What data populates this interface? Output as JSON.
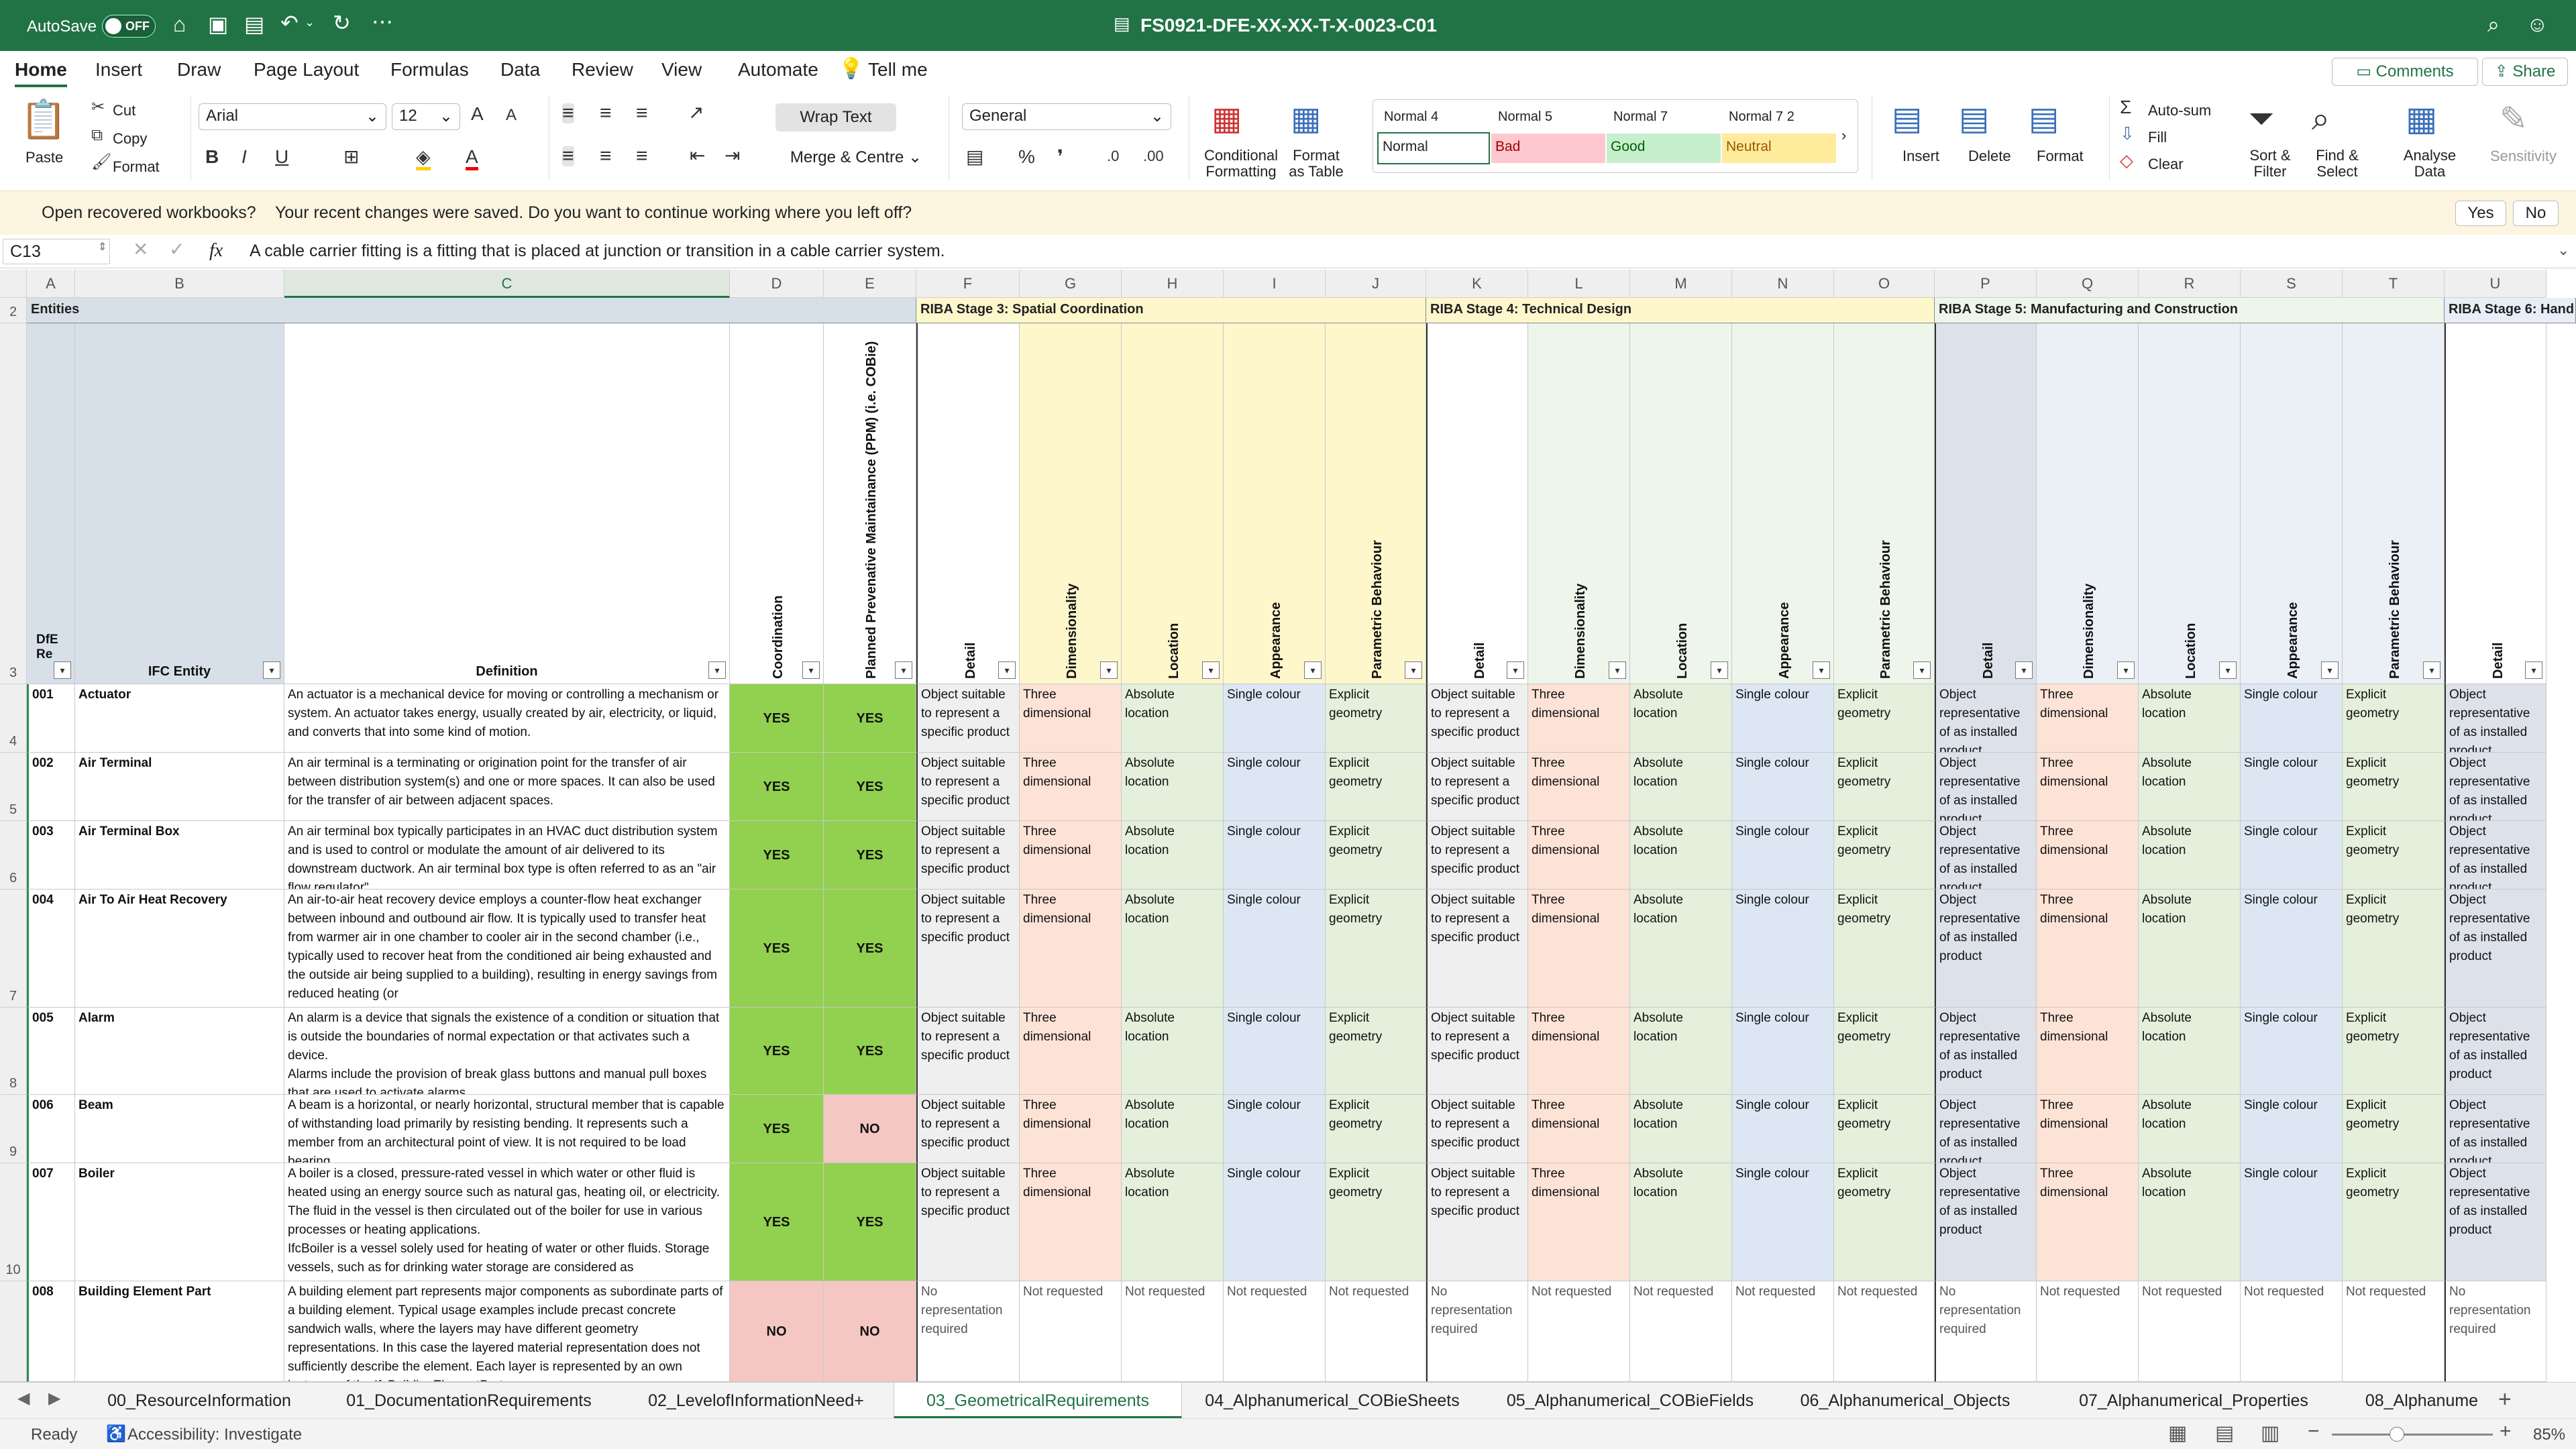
{
  "titlebar": {
    "autosave": "AutoSave",
    "toggle": "OFF",
    "filename": "FS0921-DFE-XX-XX-T-X-0023-C01"
  },
  "ribbon_tabs": [
    "Home",
    "Insert",
    "Draw",
    "Page Layout",
    "Formulas",
    "Data",
    "Review",
    "View",
    "Automate",
    "Tell me"
  ],
  "ribbon_right": {
    "comments": "Comments",
    "share": "Share"
  },
  "clipboard": {
    "paste": "Paste",
    "cut": "Cut",
    "copy": "Copy",
    "format": "Format"
  },
  "font": {
    "name": "Arial",
    "size": "12"
  },
  "alignment": {
    "wrap": "Wrap Text",
    "merge": "Merge & Centre"
  },
  "number": {
    "format": "General"
  },
  "styles": {
    "cond": "Conditional Formatting",
    "table": "Format as Table",
    "names": [
      "Normal 4",
      "Normal 5",
      "Normal 7",
      "Normal 7 2"
    ],
    "cells": [
      "Normal",
      "Bad",
      "Good",
      "Neutral"
    ]
  },
  "cells_grp": {
    "insert": "Insert",
    "delete": "Delete",
    "format": "Format"
  },
  "editing": {
    "autosum": "Auto-sum",
    "fill": "Fill",
    "clear": "Clear",
    "sort": "Sort & Filter",
    "find": "Find & Select",
    "analyse": "Analyse Data",
    "sensitivity": "Sensitivity"
  },
  "message": {
    "title": "Open recovered workbooks?",
    "text": "Your recent changes were saved. Do you want to continue working where you left off?",
    "yes": "Yes",
    "no": "No"
  },
  "formula": {
    "namebox": "C13",
    "fx": "fx",
    "content": "A cable carrier fitting is a fitting that is placed at junction or transition in a cable carrier system."
  },
  "columns": [
    "A",
    "B",
    "C",
    "D",
    "E",
    "F",
    "G",
    "H",
    "I",
    "J",
    "K",
    "L",
    "M",
    "N",
    "O",
    "P",
    "Q",
    "R",
    "S",
    "T",
    "U"
  ],
  "row_numbers": [
    "2",
    "3",
    "4",
    "5",
    "6",
    "7",
    "8",
    "9",
    "10"
  ],
  "header": {
    "entities": "Entities",
    "dfe_ref": "DfE Re",
    "ifc_entity": "IFC Entity",
    "definition": "Definition",
    "coordination": "Coordination",
    "ppm": "Planned Prevenative Maintainance (PPM) (i.e. COBie)",
    "stages": [
      "RIBA Stage 3: Spatial Coordination",
      "RIBA Stage 4: Technical Design",
      "RIBA Stage 5: Manufacturing and Construction",
      "RIBA Stage 6: Hand"
    ],
    "sub": [
      "Detail",
      "Dimensionality",
      "Location",
      "Appearance",
      "Parametric Behaviour"
    ]
  },
  "rows": [
    {
      "ref": "001",
      "entity": "Actuator",
      "def": "An actuator is a mechanical device for moving or controlling a mechanism or system. An actuator takes energy, usually created by air, electricity, or liquid, and converts that into some kind of motion.",
      "coord": "YES",
      "ppm": "YES"
    },
    {
      "ref": "002",
      "entity": "Air Terminal",
      "def": "An air terminal is a terminating or origination point for the transfer of air between distribution system(s) and one or more spaces. It can also be used for the transfer of air between adjacent spaces.",
      "coord": "YES",
      "ppm": "YES"
    },
    {
      "ref": "003",
      "entity": "Air Terminal Box",
      "def": "An air terminal box typically participates in an HVAC duct distribution system and is used to control or modulate the amount of air delivered to its downstream ductwork. An air terminal box type is often referred to as an \"air flow regulator\".",
      "coord": "YES",
      "ppm": "YES"
    },
    {
      "ref": "004",
      "entity": "Air To Air Heat Recovery",
      "def": "An air-to-air heat recovery device employs a counter-flow heat exchanger between inbound and outbound air flow. It is typically used to transfer heat from warmer air in one chamber to cooler air in the second chamber (i.e., typically used to recover heat from the conditioned air being exhausted and the outside air being supplied to a building), resulting in energy savings from reduced heating (or",
      "coord": "YES",
      "ppm": "YES"
    },
    {
      "ref": "005",
      "entity": "Alarm",
      "def": "An alarm is a device that signals the existence of a condition or situation that is outside the boundaries of normal expectation or that activates such a device.\nAlarms include the provision of break glass buttons and manual pull boxes that are used to activate alarms.",
      "coord": "YES",
      "ppm": "YES"
    },
    {
      "ref": "006",
      "entity": "Beam",
      "def": "A beam is a horizontal, or nearly horizontal, structural member that is capable of withstanding load primarily by resisting bending. It represents such a member from an architectural point of view. It is not required to be load bearing.",
      "coord": "YES",
      "ppm": "NO"
    },
    {
      "ref": "007",
      "entity": "Boiler",
      "def": "A boiler is a closed, pressure-rated vessel in which water or other fluid is heated using an energy source such as natural gas, heating oil, or electricity. The fluid in the vessel is then circulated out of the boiler for use in various processes or heating applications.\nIfcBoiler is a vessel solely used for heating of water or other fluids. Storage vessels, such as for drinking water storage are considered as",
      "coord": "YES",
      "ppm": "YES"
    },
    {
      "ref": "008",
      "entity": "Building Element Part",
      "def": "A building element part represents major components as subordinate parts of a building element. Typical usage examples include precast concrete sandwich walls, where the layers may have different geometry representations. In this case the layered material representation does not sufficiently describe the element. Each layer is represented by an own instance of the IfcBuildingElementPart",
      "coord": "NO",
      "ppm": "NO"
    }
  ],
  "stage_vals": {
    "s3_detail": "Object suitable to represent a specific product",
    "s5_detail": "Object representative of as installed product",
    "dim": "Three dimensional",
    "loc": "Absolute location",
    "app": "Single colour",
    "par": "Explicit geometry",
    "no_rep": "No representation required",
    "not_req": "Not requested"
  },
  "sheet_tabs": [
    "00_ResourceInformation",
    "01_DocumentationRequirements",
    "02_LevelofInformationNeed+",
    "03_GeometricalRequirements",
    "04_Alphanumerical_COBieSheets",
    "05_Alphanumerical_COBieFields",
    "06_Alphanumerical_Objects",
    "07_Alphanumerical_Properties",
    "08_Alphanume"
  ],
  "status": {
    "ready": "Ready",
    "access": "Accessibility: Investigate",
    "zoom": "85%"
  },
  "colors": {
    "excel_green": "#217346",
    "yes_green": "#92d050",
    "no_red": "#f4c7c3"
  }
}
